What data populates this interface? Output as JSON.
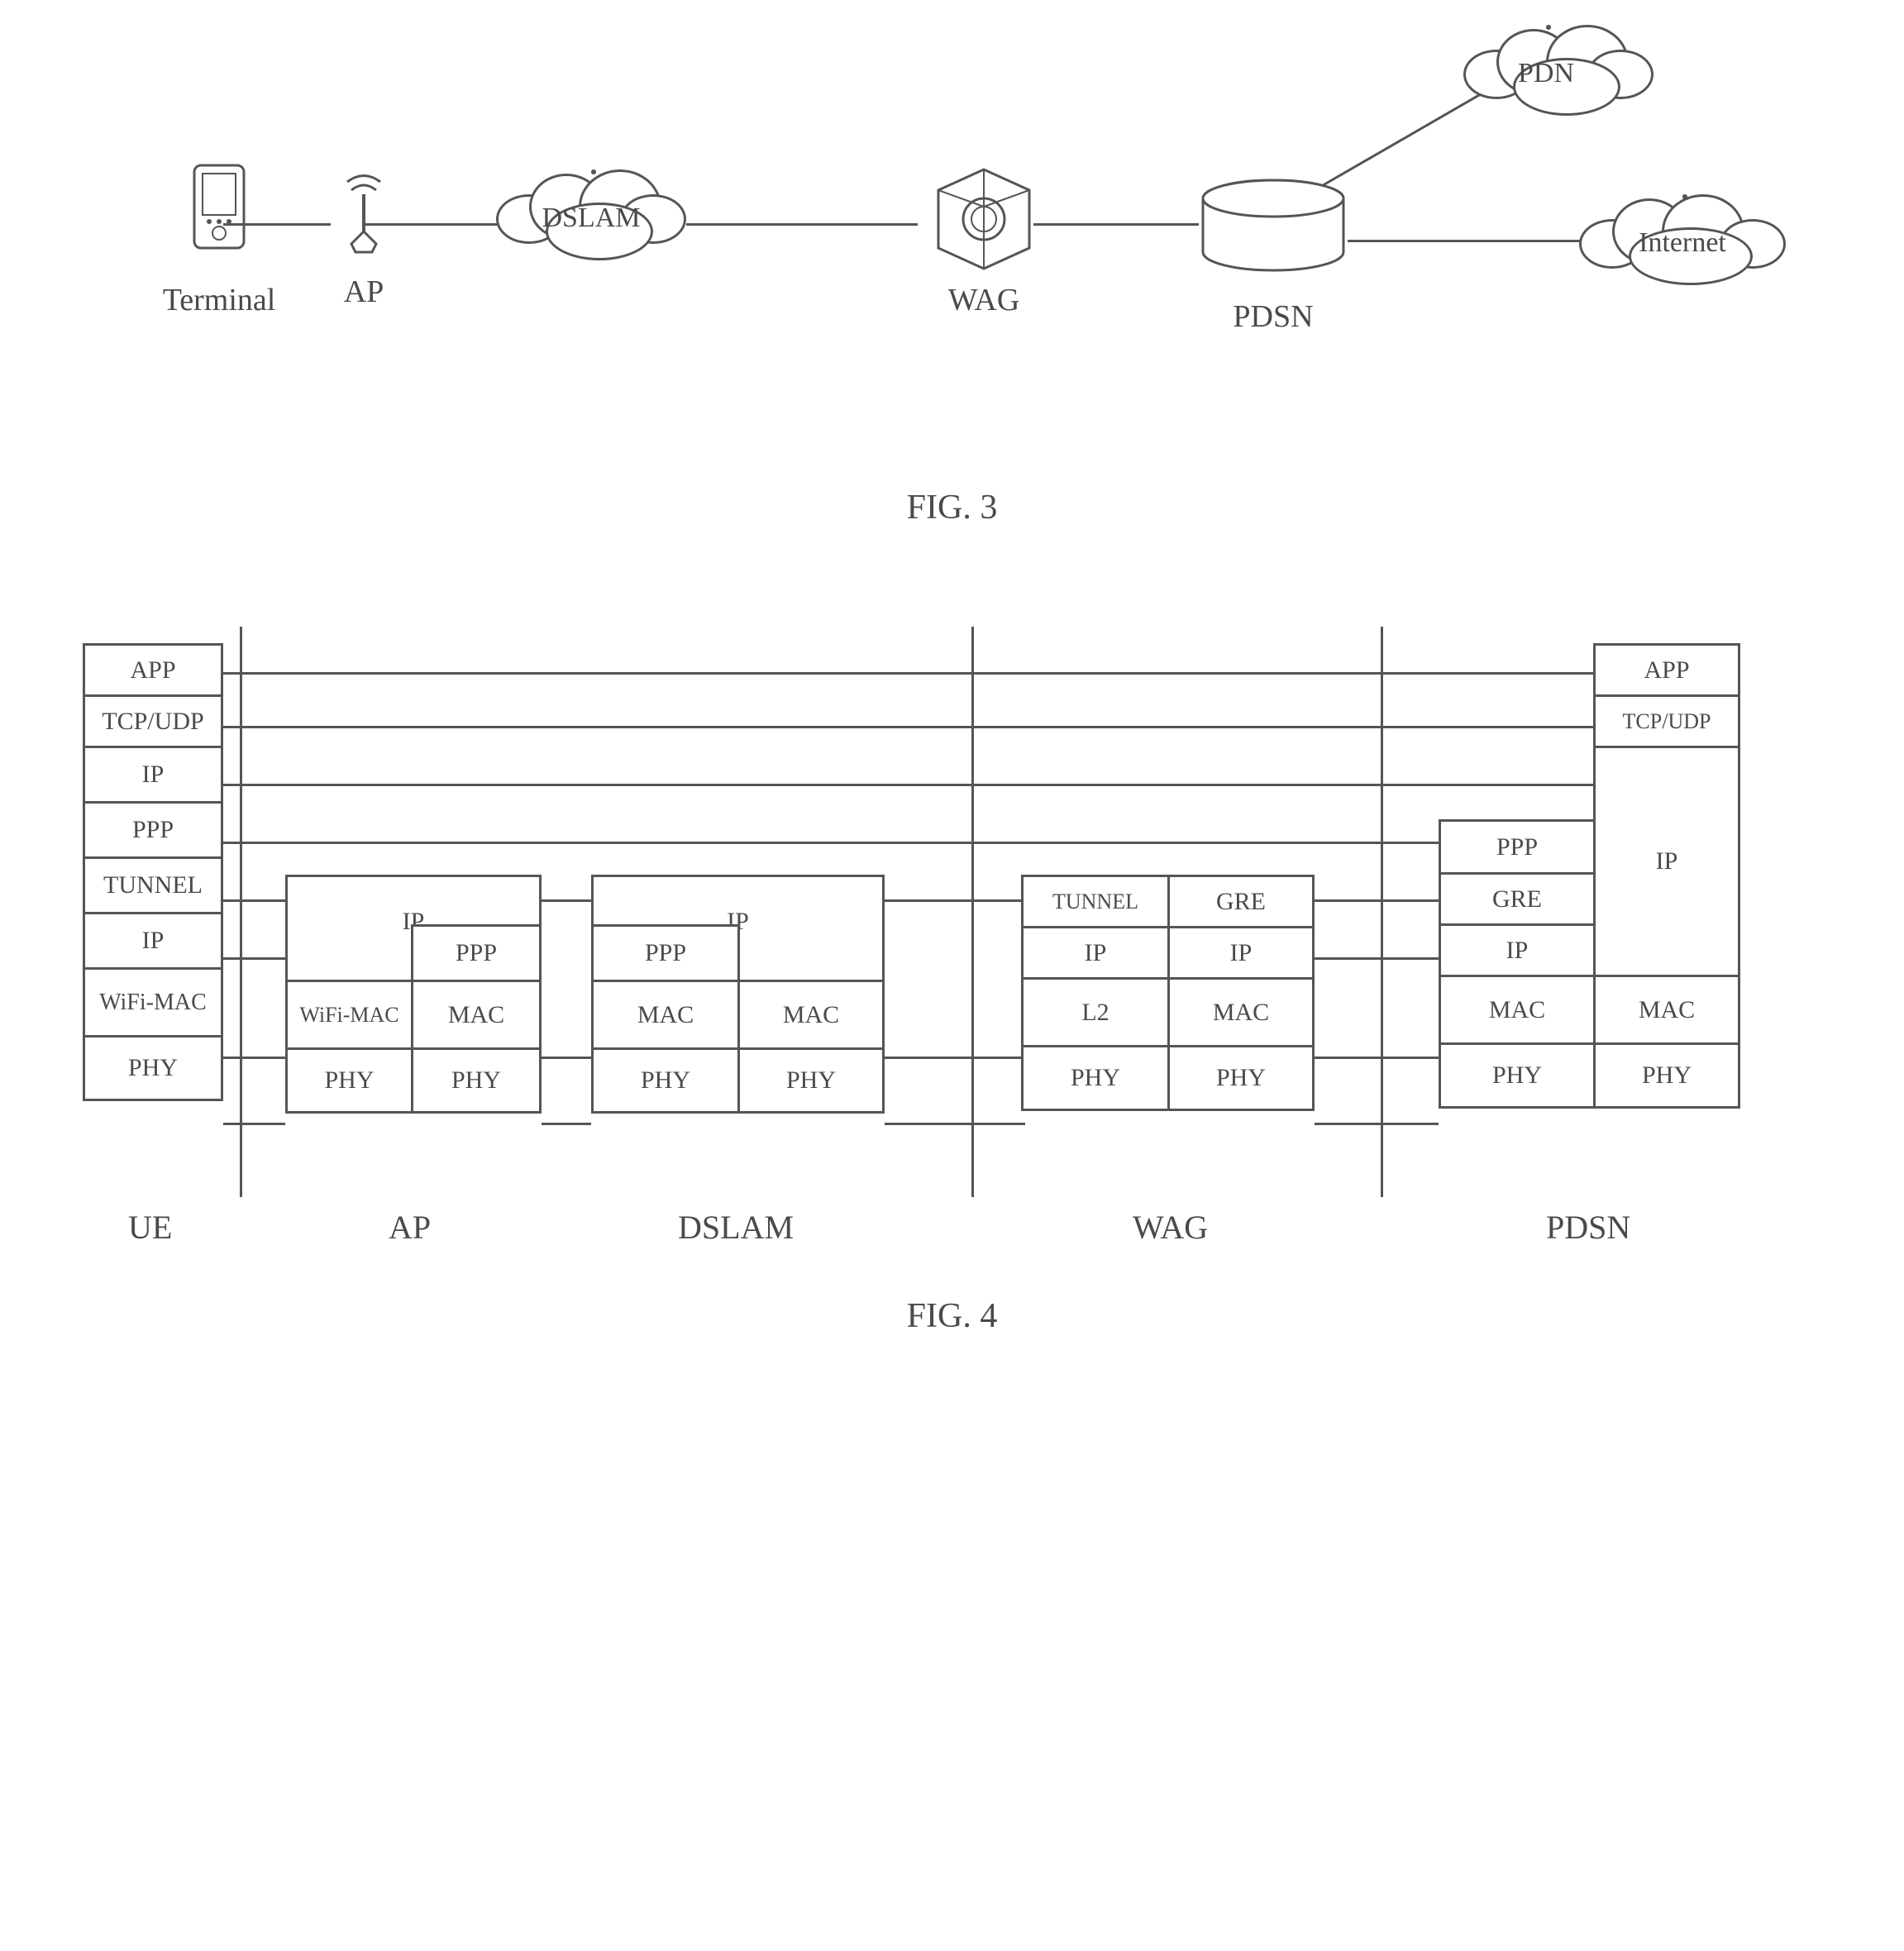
{
  "figure3": {
    "caption": "FIG. 3",
    "nodes": {
      "terminal": "Terminal",
      "ap": "AP",
      "dslam": "DSLAM",
      "wag": "WAG",
      "pdsn": "PDSN",
      "pdn": "PDN",
      "internet": "Internet"
    }
  },
  "figure4": {
    "caption": "FIG. 4",
    "sections": [
      "UE",
      "AP",
      "DSLAM",
      "WAG",
      "PDSN"
    ],
    "ue_layers": [
      "APP",
      "TCP/UDP",
      "IP",
      "PPP",
      "TUNNEL",
      "IP",
      "WiFi-MAC",
      "PHY"
    ],
    "ap_left": {
      "top": "IP",
      "cells": [
        "WiFi-MAC",
        "PHY"
      ]
    },
    "ap_right": [
      "PPP",
      "MAC",
      "PHY"
    ],
    "ap_ip_label": "IP",
    "dslam_left": [
      "PPP",
      "MAC",
      "PHY"
    ],
    "dslam_right": [
      "MAC",
      "PHY"
    ],
    "dslam_ip_label": "IP",
    "wag_left": [
      "TUNNEL",
      "IP",
      "L2",
      "PHY"
    ],
    "wag_right": [
      "GRE",
      "IP",
      "MAC",
      "PHY"
    ],
    "pdsn_left_upper": [
      "PPP",
      "GRE",
      "IP"
    ],
    "pdsn_left_lower": [
      "MAC",
      "PHY"
    ],
    "pdsn_right_upper": [
      "APP",
      "TCP/UDP"
    ],
    "pdsn_right_ip": "IP",
    "pdsn_right_lower": [
      "MAC",
      "PHY"
    ]
  },
  "chart_data": {
    "type": "table",
    "description": "Two diagrams: Fig.3 shows a network topology Terminal—AP—DSLAM—WAG—PDSN branching to PDN cloud and Internet cloud. Fig.4 shows protocol stacks for UE, AP, DSLAM, WAG, PDSN.",
    "figure3_topology": {
      "chain": [
        "Terminal",
        "AP",
        "DSLAM",
        "WAG",
        "PDSN"
      ],
      "pdsn_branches_to": [
        "PDN",
        "Internet"
      ]
    },
    "figure4_stacks": {
      "UE": [
        "APP",
        "TCP/UDP",
        "IP",
        "PPP",
        "TUNNEL",
        "IP",
        "WiFi-MAC",
        "PHY"
      ],
      "AP": {
        "left_side": [
          "IP",
          "WiFi-MAC",
          "PHY"
        ],
        "right_side": [
          "IP",
          "PPP",
          "MAC",
          "PHY"
        ]
      },
      "DSLAM": {
        "left_side": [
          "IP",
          "PPP",
          "MAC",
          "PHY"
        ],
        "right_side": [
          "IP",
          "MAC",
          "PHY"
        ]
      },
      "WAG": {
        "left_side": [
          "TUNNEL",
          "IP",
          "L2",
          "PHY"
        ],
        "right_side": [
          "GRE",
          "IP",
          "MAC",
          "PHY"
        ]
      },
      "PDSN": {
        "left_side": [
          "PPP",
          "GRE",
          "IP",
          "MAC",
          "PHY"
        ],
        "right_side": [
          "APP",
          "TCP/UDP",
          "IP",
          "MAC",
          "PHY"
        ]
      }
    },
    "peer_connections": [
      [
        "UE.APP",
        "PDSN.right.APP"
      ],
      [
        "UE.TCP/UDP",
        "PDSN.right.TCP/UDP"
      ],
      [
        "UE.IP(upper)",
        "PDSN.right.IP"
      ],
      [
        "UE.PPP",
        "PDSN.left.PPP"
      ],
      [
        "UE.TUNNEL",
        "WAG.left.TUNNEL"
      ],
      [
        "UE.IP(lower)",
        "AP.IP"
      ],
      [
        "UE.WiFi-MAC",
        "AP.left.WiFi-MAC"
      ],
      [
        "UE.PHY",
        "AP.left.PHY"
      ],
      [
        "AP.right.PHY",
        "DSLAM.left.PHY"
      ],
      [
        "AP.right.MAC",
        "DSLAM.left.MAC"
      ],
      [
        "DSLAM.right.PHY",
        "WAG.left.PHY"
      ],
      [
        "DSLAM.right.MAC",
        "WAG.left.L2"
      ],
      [
        "WAG.right.PHY",
        "PDSN.left.PHY"
      ],
      [
        "WAG.right.MAC",
        "PDSN.left.MAC"
      ],
      [
        "WAG.right.GRE",
        "PDSN.left.GRE"
      ],
      [
        "WAG.right.IP",
        "PDSN.left.IP"
      ]
    ]
  }
}
